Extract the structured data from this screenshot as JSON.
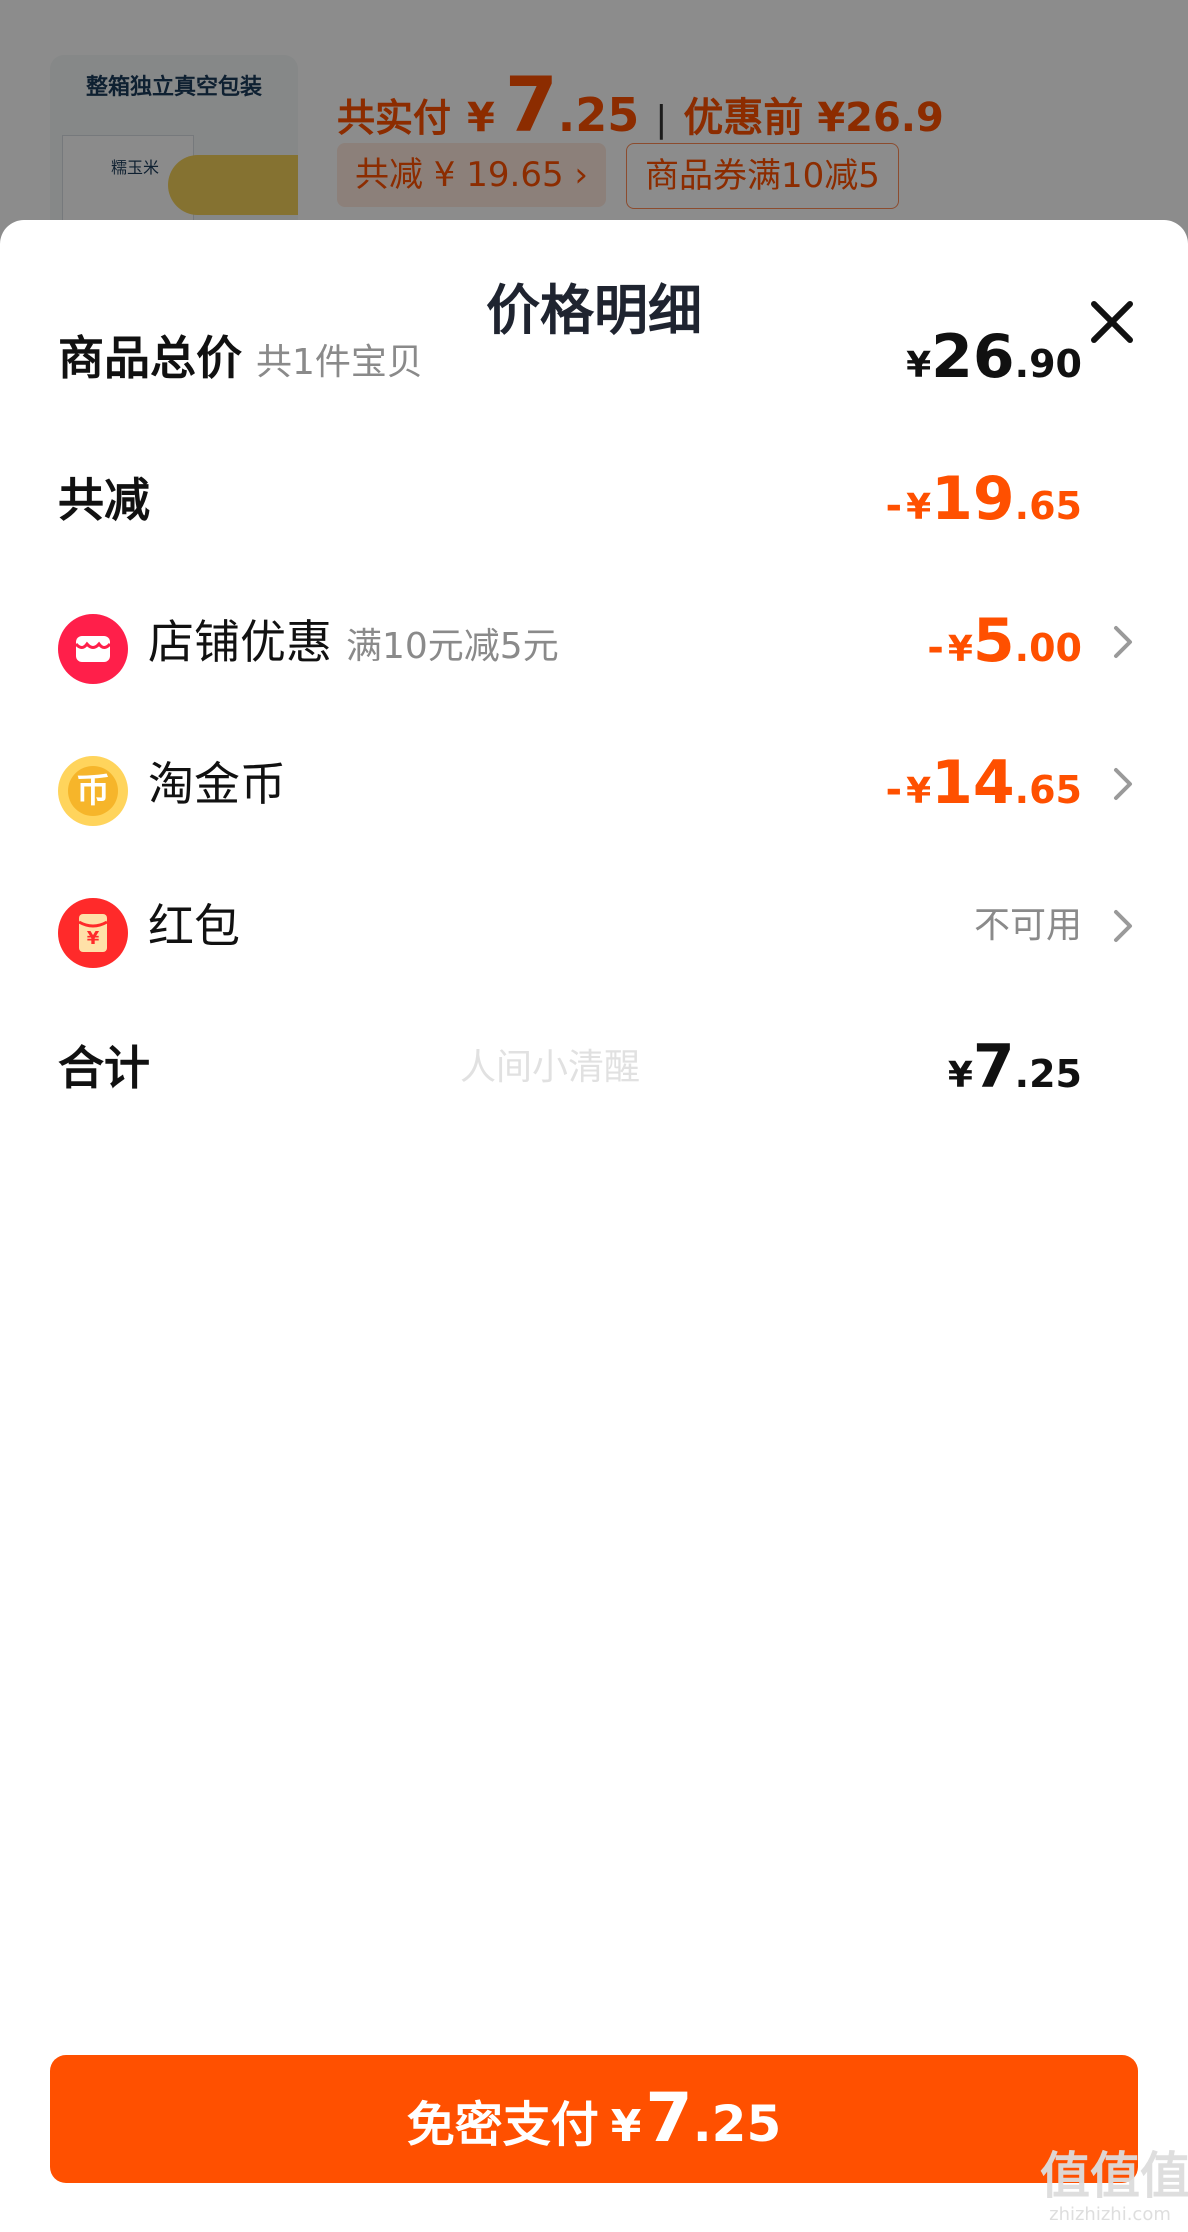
{
  "background_order": {
    "thumb_title": "整箱独立真空包装",
    "thumb_label": "糯玉米",
    "paid_label": "共实付",
    "paid_currency": "¥",
    "paid_int": "7",
    "paid_dec": ".25",
    "separator": "|",
    "before_label": "优惠前 ¥26.9",
    "tag_reduce": "共减 ¥ 19.65 ›",
    "tag_coupon": "商品券满10减5"
  },
  "sheet": {
    "title": "价格明细",
    "close_icon": "close-icon"
  },
  "rows": {
    "total": {
      "label": "商品总价",
      "sub": "共1件宝贝",
      "currency": "¥",
      "int": "26",
      "dec": ".90"
    },
    "reduce": {
      "label": "共减",
      "minus": "-",
      "currency": "¥",
      "int": "19",
      "dec": ".65"
    },
    "shop": {
      "label": "店铺优惠",
      "sub": "满10元减5元",
      "minus": "-",
      "currency": "¥",
      "int": "5",
      "dec": ".00",
      "icon": "shop-icon"
    },
    "coin": {
      "label": "淘金币",
      "minus": "-",
      "currency": "¥",
      "int": "14",
      "dec": ".65",
      "icon": "coin-icon",
      "icon_glyph": "币"
    },
    "redpacket": {
      "label": "红包",
      "status": "不可用",
      "icon": "red-packet-icon",
      "icon_glyph": "¥"
    },
    "sum": {
      "label": "合计",
      "currency": "¥",
      "int": "7",
      "dec": ".25"
    }
  },
  "watermark": "人间小清醒",
  "pay_button": {
    "label": "免密支付",
    "currency": "¥",
    "int": "7",
    "dec": ".25"
  },
  "site_mark": {
    "logo": "值值值",
    "domain": "zhizhizhi.com"
  },
  "colors": {
    "accent": "#ff5000",
    "coin": "#f6b52a",
    "shop": "#ff1f4a",
    "muted": "#8a8a8a"
  }
}
